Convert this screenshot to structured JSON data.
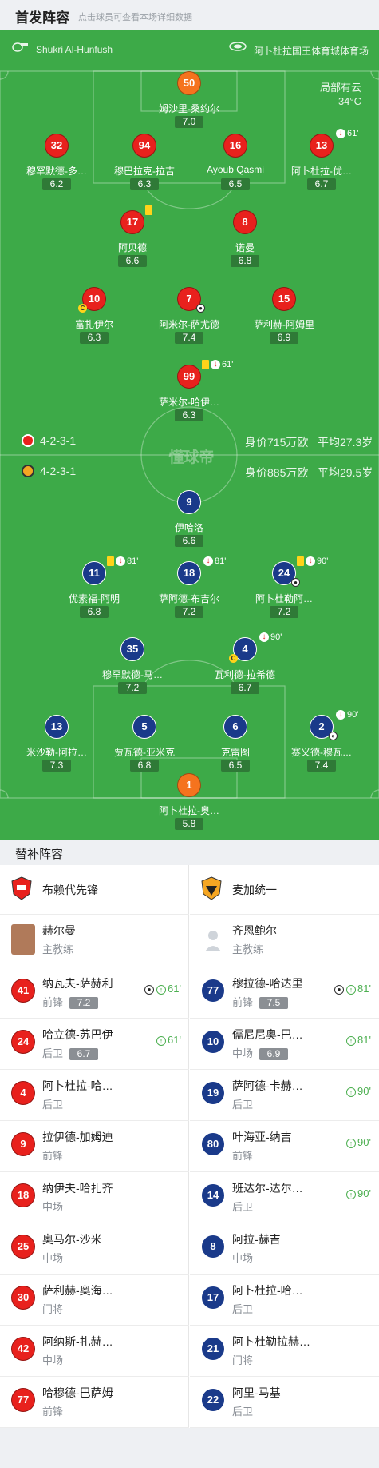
{
  "header": {
    "title": "首发阵容",
    "hint": "点击球员可查看本场详细数据"
  },
  "match_info": {
    "referee": "Shukri Al-Hunfush",
    "stadium": "阿卜杜拉国王体育城体育场",
    "weather": "局部有云",
    "temperature": "34°C"
  },
  "home_players": [
    {
      "number": "50",
      "name": "姆沙里-桑约尔",
      "rating": "7.0",
      "color": "orange"
    },
    {
      "number": "32",
      "name": "穆罕默德-多…",
      "rating": "6.2",
      "color": "red"
    },
    {
      "number": "94",
      "name": "穆巴拉克-拉吉",
      "rating": "6.3",
      "color": "red"
    },
    {
      "number": "16",
      "name": "Ayoub Qasmi",
      "rating": "6.5",
      "color": "red"
    },
    {
      "number": "13",
      "name": "阿卜杜拉-优…",
      "rating": "6.7",
      "color": "red",
      "sub_min": "61'"
    },
    {
      "number": "17",
      "name": "阿贝德",
      "rating": "6.6",
      "color": "red",
      "yellow": true
    },
    {
      "number": "8",
      "name": "诺曼",
      "rating": "6.8",
      "color": "red"
    },
    {
      "number": "10",
      "name": "富扎伊尔",
      "rating": "6.3",
      "color": "red",
      "captain": "C"
    },
    {
      "number": "7",
      "name": "阿米尔-萨尤德",
      "rating": "7.4",
      "color": "red",
      "goal": true
    },
    {
      "number": "15",
      "name": "萨利赫-阿姆里",
      "rating": "6.9",
      "color": "red"
    },
    {
      "number": "99",
      "name": "萨米尔-哈伊…",
      "rating": "6.3",
      "color": "red",
      "yellow": true,
      "sub_min": "61'"
    }
  ],
  "home_summary": {
    "formation": "4-2-3-1",
    "value": "身价715万欧",
    "avg_age": "平均27.3岁"
  },
  "away_summary": {
    "formation": "4-2-3-1",
    "value": "身价885万欧",
    "avg_age": "平均29.5岁"
  },
  "watermark": "懂球帝",
  "away_players": [
    {
      "number": "9",
      "name": "伊哈洛",
      "rating": "6.6",
      "color": "blue"
    },
    {
      "number": "11",
      "name": "优素福-阿明",
      "rating": "6.8",
      "color": "blue",
      "yellow": true,
      "sub_min": "81'"
    },
    {
      "number": "18",
      "name": "萨阿德-布吉尔",
      "rating": "7.2",
      "color": "blue",
      "sub_min": "81'"
    },
    {
      "number": "24",
      "name": "阿卜杜勒阿…",
      "rating": "7.2",
      "color": "blue",
      "yellow": true,
      "sub_min": "90'",
      "goal": true
    },
    {
      "number": "35",
      "name": "穆罕默德-马…",
      "rating": "7.2",
      "color": "blue"
    },
    {
      "number": "4",
      "name": "瓦利德-拉希德",
      "rating": "6.7",
      "color": "blue",
      "sub_min": "90'",
      "captain": "C"
    },
    {
      "number": "13",
      "name": "米沙勒-阿拉…",
      "rating": "7.3",
      "color": "blue"
    },
    {
      "number": "5",
      "name": "贾瓦德-亚米克",
      "rating": "6.8",
      "color": "blue"
    },
    {
      "number": "6",
      "name": "克雷图",
      "rating": "6.5",
      "color": "blue"
    },
    {
      "number": "2",
      "name": "赛义德-穆瓦…",
      "rating": "7.4",
      "color": "blue",
      "sub_min": "90'",
      "assist": true
    },
    {
      "number": "1",
      "name": "阿卜杜拉-奥…",
      "rating": "5.8",
      "color": "orange"
    }
  ],
  "subs_header": {
    "title": "替补阵容"
  },
  "home_team": {
    "name": "布赖代先锋",
    "coach_name": "赫尔曼",
    "coach_role": "主教练"
  },
  "away_team": {
    "name": "麦加统一",
    "coach_name": "齐恩鲍尔",
    "coach_role": "主教练"
  },
  "home_subs": [
    {
      "number": "41",
      "name": "纳瓦夫-萨赫利",
      "position": "前锋",
      "rating": "7.2",
      "goal": true,
      "sub_min": "61'"
    },
    {
      "number": "24",
      "name": "哈立德-苏巴伊",
      "position": "后卫",
      "rating": "6.7",
      "sub_min": "61'"
    },
    {
      "number": "4",
      "name": "阿卜杜拉-哈…",
      "position": "后卫"
    },
    {
      "number": "9",
      "name": "拉伊德-加姆迪",
      "position": "前锋"
    },
    {
      "number": "18",
      "name": "纳伊夫-哈扎齐",
      "position": "中场"
    },
    {
      "number": "25",
      "name": "奥马尔-沙米",
      "position": "中场"
    },
    {
      "number": "30",
      "name": "萨利赫-奥海…",
      "position": "门将"
    },
    {
      "number": "42",
      "name": "阿纳斯-扎赫…",
      "position": "中场"
    },
    {
      "number": "77",
      "name": "哈穆德-巴萨姆",
      "position": "前锋"
    }
  ],
  "away_subs": [
    {
      "number": "77",
      "name": "穆拉德-哈达里",
      "position": "前锋",
      "rating": "7.5",
      "goal": true,
      "sub_min": "81'"
    },
    {
      "number": "10",
      "name": "儒尼尼奥-巴…",
      "position": "中场",
      "rating": "6.9",
      "sub_min": "81'"
    },
    {
      "number": "19",
      "name": "萨阿德-卡赫…",
      "position": "后卫",
      "sub_min": "90'"
    },
    {
      "number": "80",
      "name": "叶海亚-纳吉",
      "position": "前锋",
      "sub_min": "90'"
    },
    {
      "number": "14",
      "name": "班达尔-达尔…",
      "position": "后卫",
      "sub_min": "90'"
    },
    {
      "number": "8",
      "name": "阿拉-赫吉",
      "position": "中场"
    },
    {
      "number": "17",
      "name": "阿卜杜拉-哈…",
      "position": "后卫"
    },
    {
      "number": "21",
      "name": "阿卜杜勒拉赫…",
      "position": "门将"
    },
    {
      "number": "22",
      "name": "阿里-马基",
      "position": "后卫"
    }
  ],
  "colors": {
    "pitch": "#3daa48",
    "home": "#e8211d",
    "away": "#1a3a8a",
    "gk": "#f5731e",
    "sub_in": "#4caf50"
  }
}
